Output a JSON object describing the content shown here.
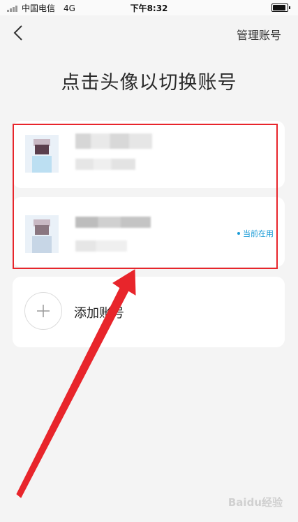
{
  "status_bar": {
    "carrier": "中国电信",
    "network": "4G",
    "time": "下午8:32"
  },
  "nav": {
    "back_icon": "chevron-left-icon",
    "manage_label": "管理账号"
  },
  "title": "点击头像以切换账号",
  "accounts": [
    {
      "is_current": false
    },
    {
      "is_current": true,
      "badge": "当前在用"
    }
  ],
  "add_account": {
    "icon": "plus-icon",
    "label": "添加账号"
  },
  "annotation": {
    "color": "#e8252b"
  },
  "watermark": "Baidu经验",
  "colors": {
    "background": "#f4f4f4",
    "card": "#ffffff",
    "accent": "#1a9bd7"
  }
}
